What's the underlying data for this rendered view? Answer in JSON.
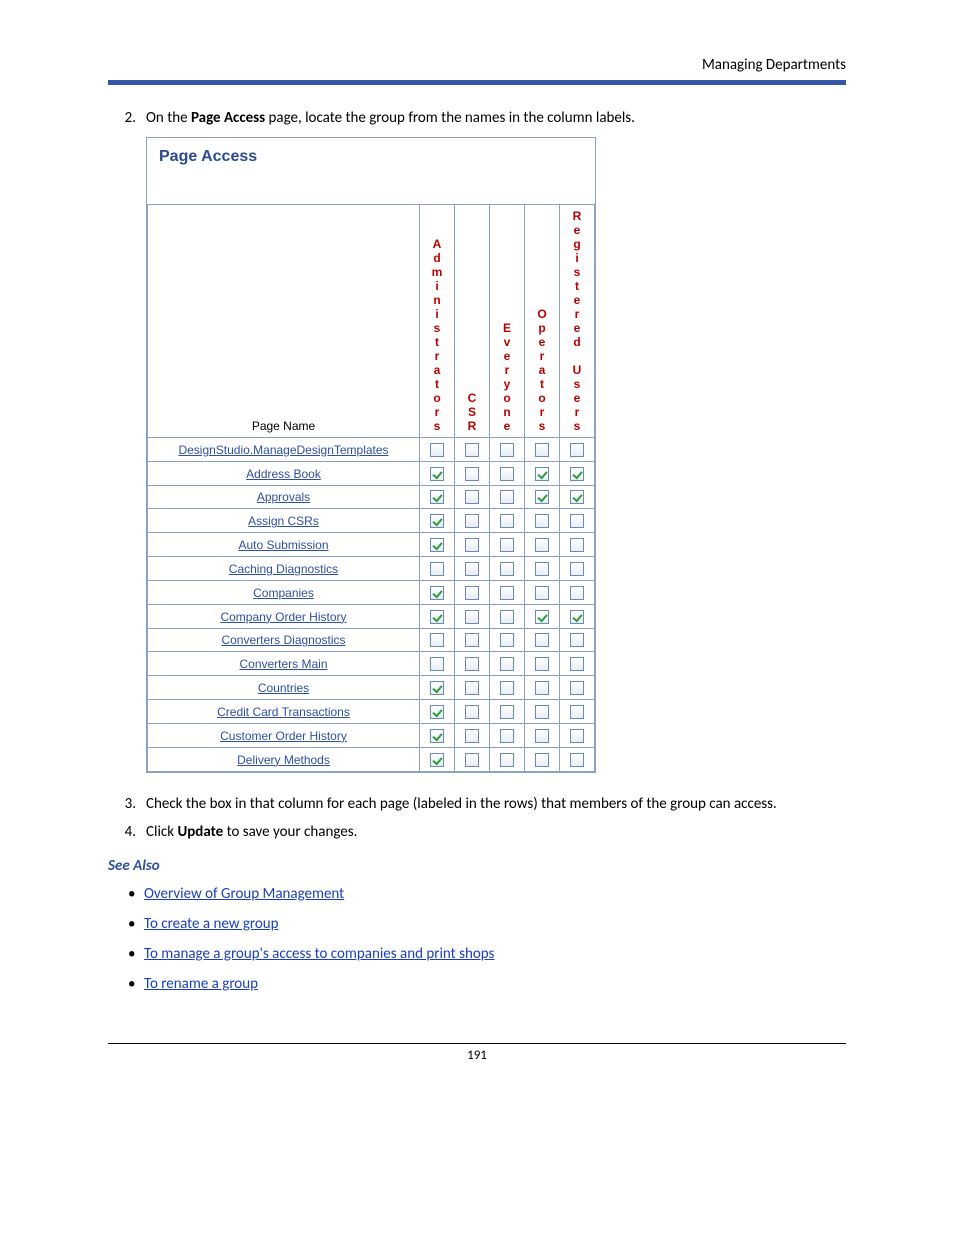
{
  "header": {
    "breadcrumb": "Managing Departments"
  },
  "steps": {
    "s2_pre": "On the ",
    "s2_bold": "Page Access",
    "s2_post": " page, locate the group from the names in the column labels.",
    "s3": "Check the box in that column for each page (labeled in the rows) that members of the group can access.",
    "s4_pre": "Click ",
    "s4_bold": "Update",
    "s4_post": " to save your changes."
  },
  "panel": {
    "title": "Page Access",
    "page_name_header": "Page Name",
    "columns": [
      "Administrators",
      "CSR",
      "Everyone",
      "Operators",
      "Registered Users"
    ],
    "rows": [
      {
        "name": "DesignStudio.ManageDesignTemplates",
        "checks": [
          false,
          false,
          false,
          false,
          false
        ]
      },
      {
        "name": "Address Book",
        "checks": [
          true,
          false,
          false,
          true,
          true
        ]
      },
      {
        "name": "Approvals",
        "checks": [
          true,
          false,
          false,
          true,
          true
        ]
      },
      {
        "name": "Assign CSRs",
        "checks": [
          true,
          false,
          false,
          false,
          false
        ]
      },
      {
        "name": "Auto Submission",
        "checks": [
          true,
          false,
          false,
          false,
          false
        ]
      },
      {
        "name": "Caching Diagnostics",
        "checks": [
          false,
          false,
          false,
          false,
          false
        ]
      },
      {
        "name": "Companies",
        "checks": [
          true,
          false,
          false,
          false,
          false
        ]
      },
      {
        "name": "Company Order History",
        "checks": [
          true,
          false,
          false,
          true,
          true
        ]
      },
      {
        "name": "Converters Diagnostics",
        "checks": [
          false,
          false,
          false,
          false,
          false
        ]
      },
      {
        "name": "Converters Main",
        "checks": [
          false,
          false,
          false,
          false,
          false
        ]
      },
      {
        "name": "Countries",
        "checks": [
          true,
          false,
          false,
          false,
          false
        ]
      },
      {
        "name": "Credit Card Transactions",
        "checks": [
          true,
          false,
          false,
          false,
          false
        ]
      },
      {
        "name": "Customer Order History",
        "checks": [
          true,
          false,
          false,
          false,
          false
        ]
      },
      {
        "name": "Delivery Methods",
        "checks": [
          true,
          false,
          false,
          false,
          false
        ]
      }
    ]
  },
  "see_also": {
    "heading": "See Also",
    "links": [
      "Overview of Group Management",
      "To create a new group",
      "To manage a group's access to companies and print shops",
      "To rename a group"
    ]
  },
  "page_number": "191"
}
